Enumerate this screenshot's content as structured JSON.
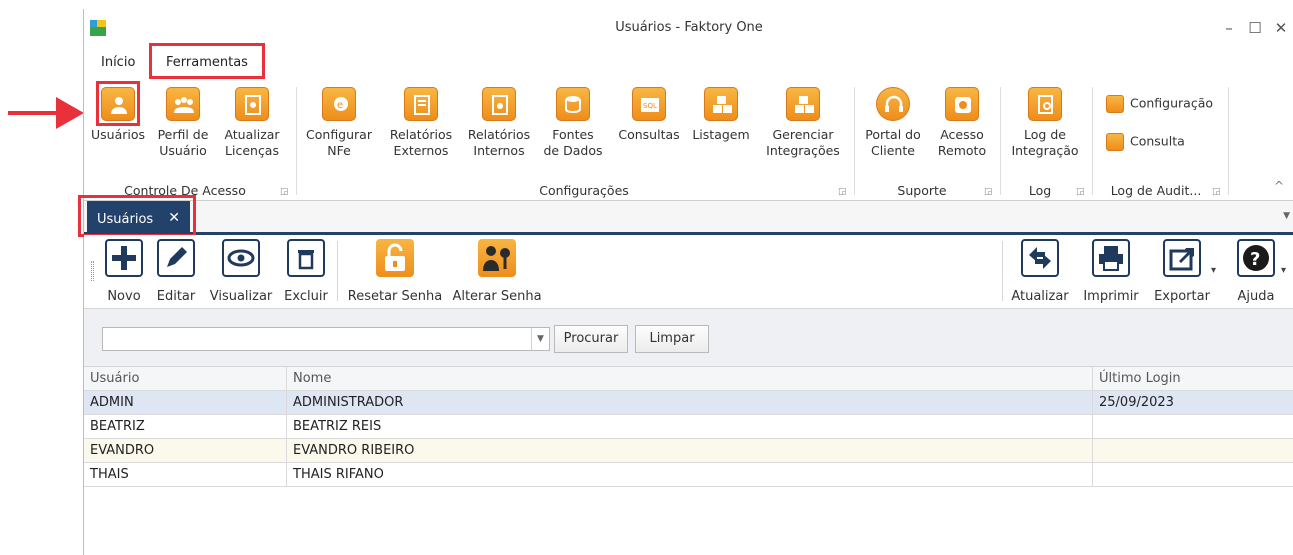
{
  "window": {
    "title": "Usuários - Faktory One",
    "minimize": "–",
    "maximize": "☐",
    "close": "✕"
  },
  "menu": {
    "inicio": "Início",
    "ferramentas": "Ferramentas"
  },
  "ribbon": {
    "groups": {
      "controle": "Controle De Acesso",
      "configuracoes": "Configurações",
      "suporte": "Suporte",
      "log": "Log",
      "log_audit": "Log de Audit..."
    },
    "buttons": {
      "usuarios": "Usuários",
      "perfil_l1": "Perfil de",
      "perfil_l2": "Usuário",
      "atualizar_l1": "Atualizar",
      "atualizar_l2": "Licenças",
      "configurar_l1": "Configurar",
      "configurar_l2": "NFe",
      "rel_ext_l1": "Relatórios",
      "rel_ext_l2": "Externos",
      "rel_int_l1": "Relatórios",
      "rel_int_l2": "Internos",
      "fontes_l1": "Fontes",
      "fontes_l2": "de Dados",
      "consultas": "Consultas",
      "listagem": "Listagem",
      "gerenciar_l1": "Gerenciar",
      "gerenciar_l2": "Integrações",
      "portal_l1": "Portal do",
      "portal_l2": "Cliente",
      "acesso_l1": "Acesso",
      "acesso_l2": "Remoto",
      "logint_l1": "Log de",
      "logint_l2": "Integração",
      "configuracao": "Configuração",
      "consulta": "Consulta"
    },
    "collapse": "^"
  },
  "tab": {
    "label": "Usuários",
    "close": "✕"
  },
  "toolbar": {
    "novo": "Novo",
    "editar": "Editar",
    "visualizar": "Visualizar",
    "excluir": "Excluir",
    "resetar": "Resetar Senha",
    "alterar": "Alterar Senha",
    "atualizar": "Atualizar",
    "imprimir": "Imprimir",
    "exportar": "Exportar",
    "ajuda": "Ajuda"
  },
  "filter": {
    "search_value": "",
    "procurar": "Procurar",
    "limpar": "Limpar"
  },
  "grid": {
    "headers": [
      "Usuário",
      "Nome",
      "Último Login"
    ],
    "rows": [
      [
        "ADMIN",
        "ADMINISTRADOR",
        "25/09/2023"
      ],
      [
        "BEATRIZ",
        "BEATRIZ REIS",
        ""
      ],
      [
        "EVANDRO",
        "EVANDRO RIBEIRO",
        ""
      ],
      [
        "THAIS",
        "THAIS RIFANO",
        ""
      ]
    ]
  },
  "colors": {
    "annotation": "#e8313b",
    "navy": "#23426b",
    "orange": "#f0941f",
    "selected_row": "#dde6f2",
    "alt_row": "#fbf9ec"
  }
}
